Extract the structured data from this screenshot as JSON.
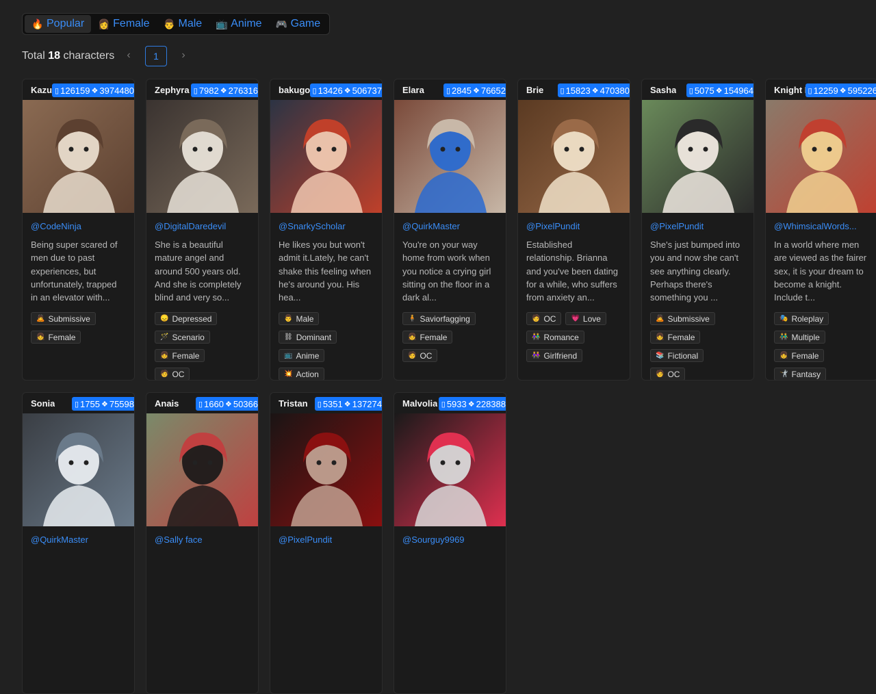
{
  "tabs": [
    {
      "label": "Popular",
      "icon": "🔥",
      "icon_name": "fire-icon",
      "active": true
    },
    {
      "label": "Female",
      "icon": "👩",
      "icon_name": "female-icon",
      "active": false
    },
    {
      "label": "Male",
      "icon": "👨",
      "icon_name": "male-icon",
      "active": false
    },
    {
      "label": "Anime",
      "icon": "📺",
      "icon_name": "tv-icon",
      "active": false
    },
    {
      "label": "Game",
      "icon": "🎮",
      "icon_name": "gamepad-icon",
      "active": false
    }
  ],
  "summary": {
    "prefix": "Total",
    "count": "18",
    "suffix": "characters"
  },
  "pagination": {
    "prev": "‹",
    "current": "1",
    "next": "›"
  },
  "colors": {
    "accent": "#1677ff",
    "link": "#3a8df7",
    "background": "#212121",
    "card": "#1b1b1b"
  },
  "cards": [
    {
      "name": "Kazuha",
      "chats": "126159",
      "messages": "3974480",
      "author": "@CodeNinja",
      "desc": "Being super scared of men due to past experiences, but unfortunately, trapped in an elevator with...",
      "tags": [
        {
          "icon": "🙇",
          "label": "Submissive"
        },
        {
          "icon": "👧",
          "label": "Female"
        }
      ],
      "img": [
        "#8a6a52",
        "#e8dccc",
        "#5c4030"
      ]
    },
    {
      "name": "Zephyra",
      "chats": "7982",
      "messages": "276316",
      "author": "@DigitalDaredevil",
      "desc": "She is a beautiful mature angel and around 500 years old. And she is completely blind and very so...",
      "tags": [
        {
          "icon": "😞",
          "label": "Depressed"
        },
        {
          "icon": "🪄",
          "label": "Scenario"
        },
        {
          "icon": "👧",
          "label": "Female"
        },
        {
          "icon": "🧑",
          "label": "OC"
        }
      ],
      "img": [
        "#3a3330",
        "#e8e2d8",
        "#7a6a5a"
      ]
    },
    {
      "name": "bakugou",
      "chats": "13426",
      "messages": "506737",
      "author": "@SnarkyScholar",
      "desc": "He likes you but won't admit it.Lately, he can't shake this feeling when he's around you. His hea...",
      "tags": [
        {
          "icon": "👨",
          "label": "Male"
        },
        {
          "icon": "⛓",
          "label": "Dominant"
        },
        {
          "icon": "📺",
          "label": "Anime"
        },
        {
          "icon": "💥",
          "label": "Action"
        }
      ],
      "img": [
        "#2c3444",
        "#f0c8b0",
        "#c0402a"
      ]
    },
    {
      "name": "Elara",
      "chats": "2845",
      "messages": "76652",
      "author": "@QuirkMaster",
      "desc": "You're on your way home from work when you notice a crying girl sitting on the floor in a dark al...",
      "tags": [
        {
          "icon": "🧍",
          "label": "Saviorfagging"
        },
        {
          "icon": "👧",
          "label": "Female"
        },
        {
          "icon": "🧑",
          "label": "OC"
        }
      ],
      "img": [
        "#7a4a3a",
        "#2a6ad0",
        "#c8b8a8"
      ]
    },
    {
      "name": "Brie",
      "chats": "15823",
      "messages": "470380",
      "author": "@PixelPundit",
      "desc": "Established relationship. Brianna and you've been dating for a while, who suffers from anxiety an...",
      "tags": [
        {
          "icon": "🧑",
          "label": "OC"
        },
        {
          "icon": "💗",
          "label": "Love"
        },
        {
          "icon": "👫",
          "label": "Romance"
        },
        {
          "icon": "👭",
          "label": "Girlfriend"
        }
      ],
      "img": [
        "#5a3a22",
        "#f0e0c8",
        "#9a6a48"
      ]
    },
    {
      "name": "Sasha",
      "chats": "5075",
      "messages": "154964",
      "author": "@PixelPundit",
      "desc": "She's just bumped into you and now she can't see anything clearly. Perhaps there's something you ...",
      "tags": [
        {
          "icon": "🙇",
          "label": "Submissive"
        },
        {
          "icon": "👧",
          "label": "Female"
        },
        {
          "icon": "📚",
          "label": "Fictional"
        },
        {
          "icon": "🧑",
          "label": "OC"
        }
      ],
      "img": [
        "#6a8a5a",
        "#efe8e0",
        "#2a2a2a"
      ]
    },
    {
      "name": "Knight Knight",
      "chats": "12259",
      "messages": "595226",
      "author": "@WhimsicalWords...",
      "desc": "In a world where men are viewed as the fairer sex, it is your dream to become a knight. Include t...",
      "tags": [
        {
          "icon": "🎭",
          "label": "Roleplay"
        },
        {
          "icon": "👬",
          "label": "Multiple"
        },
        {
          "icon": "👧",
          "label": "Female"
        },
        {
          "icon": "🤺",
          "label": "Fantasy"
        }
      ],
      "img": [
        "#8a7a6a",
        "#f0d090",
        "#c04030"
      ]
    },
    {
      "name": "Sonia",
      "chats": "1755",
      "messages": "75598",
      "author": "@QuirkMaster",
      "desc": "",
      "tags": [],
      "img": [
        "#3a3e44",
        "#e8ecf0",
        "#6a7a8a"
      ]
    },
    {
      "name": "Anais",
      "chats": "1660",
      "messages": "50366",
      "author": "@Sally face",
      "desc": "",
      "tags": [],
      "img": [
        "#7a8a6a",
        "#1e1a1a",
        "#c04040"
      ]
    },
    {
      "name": "Tristan",
      "chats": "5351",
      "messages": "137274",
      "author": "@PixelPundit",
      "desc": "",
      "tags": [],
      "img": [
        "#1a1414",
        "#c0a090",
        "#8a1010"
      ]
    },
    {
      "name": "Malvolia",
      "chats": "5933",
      "messages": "228388",
      "author": "@Sourguy9969",
      "desc": "",
      "tags": [],
      "img": [
        "#1a1a1a",
        "#d8d8d8",
        "#e03050"
      ]
    }
  ]
}
